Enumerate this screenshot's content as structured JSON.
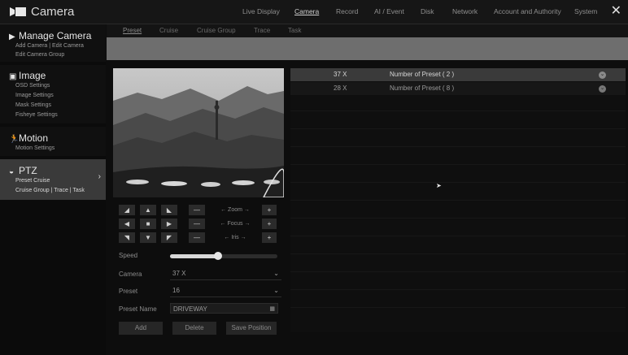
{
  "app": {
    "title": "Camera"
  },
  "top_menu": [
    {
      "label": "Live Display",
      "active": false
    },
    {
      "label": "Camera",
      "active": true
    },
    {
      "label": "Record",
      "active": false
    },
    {
      "label": "AI / Event",
      "active": false
    },
    {
      "label": "Disk",
      "active": false
    },
    {
      "label": "Network",
      "active": false
    },
    {
      "label": "Account and Authority",
      "active": false
    },
    {
      "label": "System",
      "active": false
    }
  ],
  "close_glyph": "✕",
  "sidebar": {
    "manage": {
      "title": "Manage Camera",
      "items": [
        "Add Camera | Edit Camera",
        "Edit Camera Group"
      ]
    },
    "image": {
      "title": "Image",
      "items": [
        "OSD Settings",
        "Image Settings",
        "Mask Settings",
        "Fisheye Settings"
      ]
    },
    "motion": {
      "title": "Motion",
      "items": [
        "Motion Settings"
      ]
    },
    "ptz": {
      "title": "PTZ",
      "items": [
        "Preset  Cruise",
        "Cruise Group | Trace | Task"
      ]
    }
  },
  "tabs": [
    {
      "label": "Preset",
      "active": true
    },
    {
      "label": "Cruise",
      "active": false
    },
    {
      "label": "Cruise Group",
      "active": false
    },
    {
      "label": "Trace",
      "active": false
    },
    {
      "label": "Task",
      "active": false
    }
  ],
  "ptz_controls": {
    "zoom_label": "Zoom",
    "focus_label": "Focus",
    "iris_label": "Iris",
    "minus": "—",
    "plus": "+"
  },
  "speed": {
    "label": "Speed",
    "value": 0.45
  },
  "form": {
    "camera_label": "Camera",
    "camera_value": "37 X",
    "preset_label": "Preset",
    "preset_value": "16",
    "preset_name_label": "Preset Name",
    "preset_name_value": "DRIVEWAY"
  },
  "buttons": {
    "add": "Add",
    "delete": "Delete",
    "save_position": "Save Position"
  },
  "preset_list": [
    {
      "camera": "37 X",
      "summary": "Number of Preset ( 2 )"
    },
    {
      "camera": "28 X",
      "summary": "Number of Preset ( 8 )"
    }
  ]
}
